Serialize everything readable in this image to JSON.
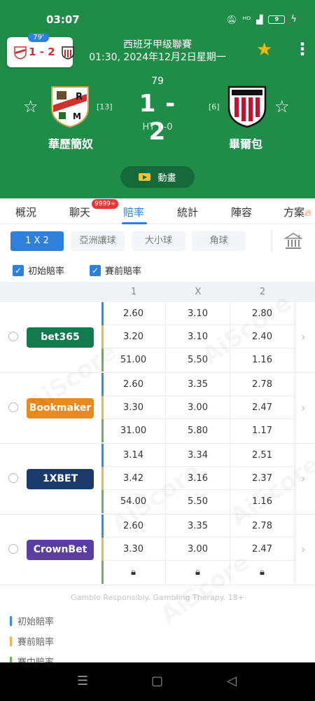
{
  "status": {
    "time": "03:07",
    "icons": [
      "mute-icon",
      "hd-icon",
      "signal-icon",
      "battery-icon"
    ],
    "battery": "9"
  },
  "mini": {
    "minute": "79'",
    "score": "1 - 2"
  },
  "match": {
    "league": "西班牙甲级聯賽",
    "datetime": "01:30, 2024年12月2日星期一",
    "minute": "79",
    "score": "1 - 2",
    "ht": "HT 1-0",
    "home": {
      "name": "華歷簡奴",
      "rank": "[13]"
    },
    "away": {
      "name": "畢爾包",
      "rank": "[6]"
    },
    "animation_label": "動畫"
  },
  "tabs": [
    {
      "label": "概況"
    },
    {
      "label": "聊天",
      "badge": "9999+"
    },
    {
      "label": "賠率"
    },
    {
      "label": "統計"
    },
    {
      "label": "陣容"
    },
    {
      "label": "方案"
    }
  ],
  "filters": [
    "1 X 2",
    "亞洲讓球",
    "大小球",
    "角球"
  ],
  "checks": [
    "初始賠率",
    "賽前賠率"
  ],
  "columns": [
    "1",
    "X",
    "2"
  ],
  "bookmakers": [
    {
      "name": "bet365",
      "color": "#137a4d",
      "rows": [
        [
          "2.60",
          "3.10",
          "2.80"
        ],
        [
          "3.20",
          "3.10",
          "2.40"
        ],
        [
          "51.00",
          "5.50",
          "1.16"
        ]
      ]
    },
    {
      "name": "Bookmaker",
      "color": "#ea8a1c",
      "rows": [
        [
          "2.60",
          "3.35",
          "2.78"
        ],
        [
          "3.30",
          "3.00",
          "2.47"
        ],
        [
          "31.00",
          "5.80",
          "1.17"
        ]
      ]
    },
    {
      "name": "1XBET",
      "color": "#1b3a6b",
      "rows": [
        [
          "3.14",
          "3.34",
          "2.51"
        ],
        [
          "3.42",
          "3.16",
          "2.37"
        ],
        [
          "54.00",
          "5.50",
          "1.16"
        ]
      ]
    },
    {
      "name": "CrownBet",
      "color": "#5a3fa0",
      "rows": [
        [
          "2.60",
          "3.35",
          "2.78"
        ],
        [
          "3.30",
          "3.00",
          "2.47"
        ]
      ]
    }
  ],
  "disclaimer": "Gamble Responsibly. Gambling Therapy. 18+",
  "legend": [
    {
      "label": "初始賠率",
      "color": "#2f8fe0"
    },
    {
      "label": "賽前賠率",
      "color": "#f0b35b"
    },
    {
      "label": "賽中賠率",
      "color": "#67b84a"
    }
  ],
  "row_colors": [
    "#2f8fe0",
    "#f0b35b",
    "#67b84a"
  ],
  "watermark": "AiScore"
}
